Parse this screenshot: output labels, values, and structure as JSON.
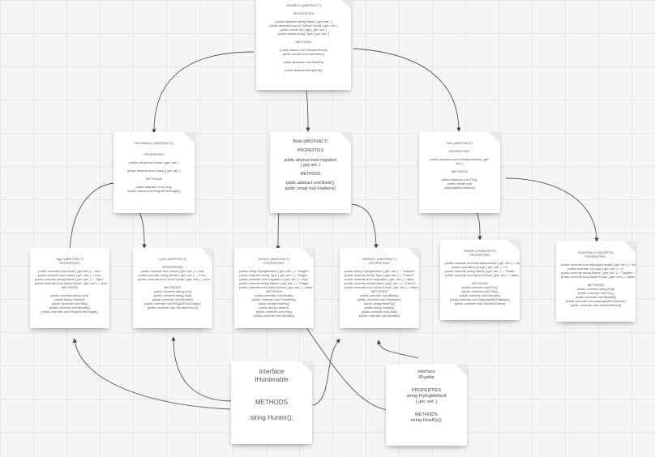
{
  "cards": {
    "animals": {
      "title": "ANIMALS (ABSTRACT)",
      "properties_label": "PROPERTIES",
      "properties": [
        "public abstract string Name { get; set; }",
        "public abstract bool IsTheNocTurnal { get; set; }",
        "public virtual int Legs { get; set; }",
        "public virtual string Type { get; set; }"
      ],
      "methods_label": "METHODS",
      "methods": [
        "public virtual void ShowerStorm()",
        "public virtual bool canSleep()",
        "public abstract void Breath()",
        "public abstract string Eat()"
      ]
    },
    "mammals": {
      "title": "MYLMMALS (ABSTRACT)",
      "properties_label": "PROPERTIES",
      "properties": [
        "public virtual bool tooth { get; set; }",
        "public abstract bool claws { get; set; }"
      ],
      "methods_label": "METHODS",
      "methods": [
        "public abstract void run();",
        "public virtual void RingOfFireJungle()"
      ]
    },
    "birds": {
      "title": "Birds (ABSTRACT)",
      "properties_label": "PROPERTIES",
      "properties": [
        "public abstract bool migration",
        "{ get; set; }"
      ],
      "methods_label": "METHODS",
      "methods": [
        "public abstract void Beak();",
        "public virtual void Feathers()"
      ]
    },
    "fish": {
      "title": "Fish (ABSTRACT)",
      "properties_label": "PROPERTIES",
      "properties": [
        "public abstract bool friendlyAnimals { get;",
        "set; }"
      ],
      "methods_label": "METHODS",
      "methods": [
        "public abstract void Fin();",
        "public virtual void",
        "playingWithChildren()"
      ]
    },
    "tiger": {
      "title": "Tiger (ABSTRACT)",
      "properties_label": "PROPERTIES",
      "properties": [
        "public override bool tooth { get; set; } = true;",
        "public override bool claws { get; set; } = true;",
        "public override string Name { get; set; } = \"Tiger\";",
        "public override bool IsNocTurnal { get; set; } = true;"
      ],
      "methods_label": "METHODS",
      "methods": [
        "public override string run()",
        "public string Hunter()",
        "public override void Eat()",
        "public override void Breath()",
        "public override void RingOfFireJungle()"
      ]
    },
    "lion": {
      "title": "LION (ABSTRACT)",
      "properties_label": "PROPERTIES",
      "properties": [
        "public override bool claws { get; set; } = true;",
        "public override string Name { get; set; } = \"Lion\";",
        "public override bool IsNocTurnal { get; set; } = true;"
      ],
      "methods_label": "METHODS",
      "methods": [
        "public override string run()",
        "public override string Eat()",
        "public override void Breath()",
        "public override void RingOfFireJungle()",
        "public override void ShowerStorm()"
      ]
    },
    "eagle": {
      "title": "EAGLE (ABSTRACT)",
      "properties_label": "PROPERTIES",
      "properties": [
        "public string FlyingMethod { get; set; } = \"Height\";",
        "public override string Type { get; set; } = \"Eagle\";",
        "public override bool migration { get; set; } = true;",
        "public override string Name { get; set; } = \"Eagle\";",
        "public override bool IsNocTurnal { get; set; } = false;"
      ],
      "methods_label": "METHODS",
      "methods": [
        "public override void Beak()",
        "public override void Feathers()",
        "public string HowFly()",
        "public string Hunter()",
        "public override void Eat()",
        "public override void Breath()"
      ]
    },
    "parrot": {
      "title": "PARROT (ABSTRACT)",
      "properties_label": "PROPERTIES",
      "properties": [
        "public string FlyingMethod { get; set; } = \"Dancer\";",
        "public override string Type { get; set; } = \"Parrot\";",
        "public override bool migration { get; set; } = false;",
        "public override string Name { get; set; } = \"Parrot\";",
        "public override bool IsNocTurnal { get; set; } = false;"
      ],
      "methods_label": "METHODS",
      "methods": [
        "public override void Beak()",
        "public override void Feathers()",
        "public string HowFly()",
        "public string Hunter()",
        "public override void Eat()",
        "public override void Breath()"
      ]
    },
    "shark": {
      "title": "SHARK (CONCRETE)",
      "subtitle": "PROPERTIES",
      "properties": [
        "public override bool friendlyAnimals { get; set; } = false;",
        "public override int Legs { get; set; } = 0;",
        "public override string Name { get; set; } = \"Shark\";",
        "public override bool IsNocTurnal { get; set; } = false;"
      ],
      "methods_label": "METHODS",
      "methods": [
        "public override void Fin()",
        "public override void Eat()",
        "public override void Breath()",
        "public override void playingWithChildren()",
        "public override void ShowerStorm()"
      ]
    },
    "dolphin": {
      "title": "DOLPHIN (CONCRETE)",
      "subtitle": "PROPERTIES",
      "properties": [
        "public override bool friendlyAnimals { get; set; } = true;",
        "public override int Legs { get; set; } = 0;",
        "public override string Name { get; set; } = \"Dolphin\";",
        "public override bool IsNocTurnal { get; set; } = false;"
      ],
      "methods_label": "METHODS",
      "methods": [
        "public override string Eat()",
        "public override void Fin()",
        "public override void Breath()",
        "public override void playingWithChildren()",
        "public override void ShowerStorm()"
      ]
    },
    "ihunterable": {
      "line1": "interface",
      "line2": "IHunterable",
      "methods_label": "METHODS",
      "methods": [
        "string Hunter();"
      ]
    },
    "iflyable": {
      "line1": "interface",
      "line2": "IFlyable",
      "properties_label": "PROPERTIES",
      "properties": [
        "string FlyingMethod",
        "{ get; set; }"
      ],
      "methods_label": "METHODS",
      "methods": [
        "string HowFly();"
      ]
    }
  }
}
